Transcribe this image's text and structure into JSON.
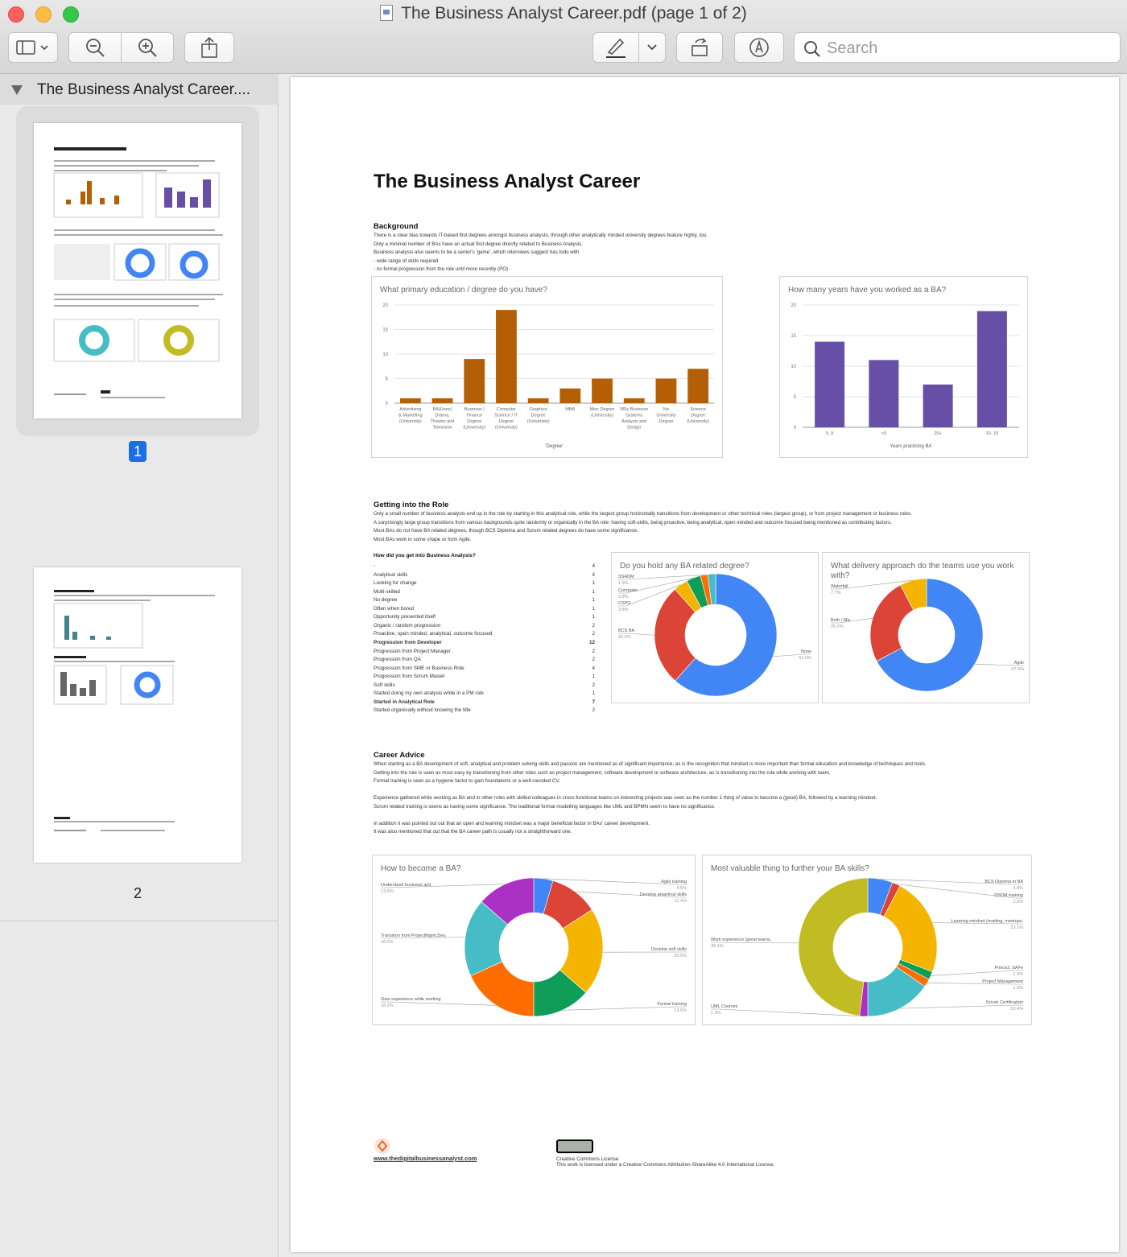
{
  "window": {
    "title": "The Business Analyst Career.pdf (page 1 of 2)",
    "search_placeholder": "Search"
  },
  "sidebar": {
    "doc_title": "The Business Analyst Career....",
    "page1": "1",
    "page2": "2"
  },
  "doc": {
    "title": "The Business Analyst Career",
    "background_heading": "Background",
    "background_text": [
      "There is a clear bias towards IT-based first degrees amongst business analysts, through other analytically minded university degrees feature highly, too.",
      "Only a minimal number of BAs have an actual first degree directly related to Business Analysis.",
      "Business analysis also seems to be a senior's 'game', which interviews suggest has todo with",
      "- wide range of skills required",
      "- no formal progression from the role until more recently (PO)"
    ],
    "role_heading": "Getting into the Role",
    "role_text": [
      "Only a small number of business analysts end up in the role by starting in this analytical role, while the largest group horizontally transitions from development or other technical roles (largest group), or from project management or business roles.",
      "A surprisingly large group transitions from various backgrounds quite randomly or organically in the BA role: having soft-skills, being proactive, being analytical, open minded and outcome focused being mentioned as contributing factors.",
      "Most BAs do not have BA related degrees, though BCS Diploma and Scrum related degrees do have some significance.",
      "Most BAs work in some shape or form Agile."
    ],
    "how_heading": "How did you get into Business Analysis?",
    "how_rows": [
      {
        "label": "-",
        "value": "4",
        "bold": false
      },
      {
        "label": "Analytical skills",
        "value": "4",
        "bold": false
      },
      {
        "label": "Looking for change",
        "value": "1",
        "bold": false
      },
      {
        "label": "Multi-skilled",
        "value": "1",
        "bold": false
      },
      {
        "label": "No degree",
        "value": "1",
        "bold": false
      },
      {
        "label": "Often when bored",
        "value": "1",
        "bold": false
      },
      {
        "label": "Opportunity presented itself",
        "value": "1",
        "bold": false
      },
      {
        "label": "Organic / random progression",
        "value": "2",
        "bold": false
      },
      {
        "label": "Proactive, open minded, analytical, outcome focused",
        "value": "2",
        "bold": false
      },
      {
        "label": "Progression from Developer",
        "value": "12",
        "bold": true
      },
      {
        "label": "Progression from Project Manager",
        "value": "2",
        "bold": false
      },
      {
        "label": "Progression from QA",
        "value": "2",
        "bold": false
      },
      {
        "label": "Progression from SME or Business Role",
        "value": "4",
        "bold": false
      },
      {
        "label": "Progression from Scrum Master",
        "value": "1",
        "bold": false
      },
      {
        "label": "Soft skills",
        "value": "2",
        "bold": false
      },
      {
        "label": "Started doing my own analysis while in a PM role",
        "value": "1",
        "bold": false
      },
      {
        "label": "Started in Analytical Role",
        "value": "7",
        "bold": true
      },
      {
        "label": "Started organically without knowing the title",
        "value": "2",
        "bold": false
      }
    ],
    "advice_heading": "Career Advice",
    "advice_text": [
      "When starting as a BA development of soft, analytical and problem solving skills and passion are mentioned as of significant importance, as is the recognition that mindset is more important than formal education and knowledge of techniques and tools.",
      "Getting into the role is seen as most easy by transitioning from other roles such as project management, software development or software architecture, as is transitioning into the role while working with team.",
      "Formal training is seen as a hygiene factor to gain foundations or a well-rounded CV.",
      "",
      "Experience gathered while working as BA and in other roles with skilled colleagues in cross-functional teams on interesting projects was seen as the number 1 thing of value to become a (good) BA, followed by a learning mindset.",
      "Scrum related training is seens as having some significance. The traditional formal modelling languages like UML and BPMN seem to have no significance.",
      "",
      "In addition it was pointed out out that an open and learning mindset was a major beneficial factor in BAs' career development.",
      "It was also mentioned that out that the BA career path is usually not a straightforward one."
    ],
    "footer_link": "www.thedigitalbusinessanalyst.com",
    "footer_cc1": "Creative Commons License",
    "footer_cc2": "This work is licensed under a Creative Commons Attribution-ShareAlike 4.0 International License."
  },
  "chart_data": [
    {
      "type": "bar",
      "title": "What primary education / degree do you have?",
      "xlabel": "'Degree'",
      "ylabel": "",
      "ylim": [
        0,
        20
      ],
      "yticks": [
        0,
        5,
        10,
        15,
        20
      ],
      "color": "#b45f06",
      "categories": [
        "Advertising & Marketing (University)",
        "BA(Hons) Drama, Theatre and Television",
        "Business / Finance Degree (University)",
        "Computer Science / IT Degree (University)",
        "Graphics Degree (University)",
        "MBA",
        "Misc Degree (University)",
        "MSc Business Systems Analysis and Design",
        "No University Degree",
        "Science Degree (University)"
      ],
      "values": [
        1,
        1,
        9,
        19,
        1,
        3,
        5,
        1,
        5,
        7
      ]
    },
    {
      "type": "bar",
      "title": "How many years have you worked as a BA?",
      "xlabel": "Years practicing BA",
      "ylabel": "",
      "ylim": [
        0,
        20
      ],
      "yticks": [
        0,
        5,
        10,
        15,
        20
      ],
      "color": "#674ea7",
      "categories": [
        "5..9",
        "<5",
        "20+",
        "10..19"
      ],
      "values": [
        14,
        11,
        7,
        19
      ]
    },
    {
      "type": "pie",
      "title": "Do you hold any BA related degree?",
      "slices": [
        {
          "label": "None",
          "pct": "61.5%",
          "value": 61.5,
          "color": "#4285f4"
        },
        {
          "label": "BCS BA",
          "pct": "26.9%",
          "value": 26.9,
          "color": "#db4437"
        },
        {
          "label": "CSPO",
          "pct": "3.8%",
          "value": 3.8,
          "color": "#f4b400"
        },
        {
          "label": "Computer",
          "pct": "3.8%",
          "value": 3.8,
          "color": "#0f9d58"
        },
        {
          "label": "SSADM",
          "pct": "1.9%",
          "value": 1.9,
          "color": "#ff6d00"
        },
        {
          "label": "",
          "pct": "",
          "value": 2.1,
          "color": "#46bdc6"
        }
      ]
    },
    {
      "type": "pie",
      "title": "What delivery approach do the teams use you work with?",
      "slices": [
        {
          "label": "Agile",
          "pct": "67.3%",
          "value": 67.3,
          "color": "#4285f4"
        },
        {
          "label": "Both / Mix",
          "pct": "25.0%",
          "value": 25.0,
          "color": "#db4437"
        },
        {
          "label": "Waterfall",
          "pct": "7.7%",
          "value": 7.7,
          "color": "#f4b400"
        }
      ]
    },
    {
      "type": "pie",
      "title": "How to become a BA?",
      "slices": [
        {
          "label": "Agile training",
          "pct": "4.5%",
          "value": 4.5,
          "color": "#4285f4"
        },
        {
          "label": "Develop analytical skills",
          "pct": "11.4%",
          "value": 11.4,
          "color": "#db4437"
        },
        {
          "label": "Develop soft skills",
          "pct": "20.5%",
          "value": 20.5,
          "color": "#f4b400"
        },
        {
          "label": "Formal training",
          "pct": "13.6%",
          "value": 13.6,
          "color": "#0f9d58"
        },
        {
          "label": "Gain experience while working",
          "pct": "18.2%",
          "value": 18.2,
          "color": "#ff6d00"
        },
        {
          "label": "Transition from ProjectMgmt,Dev,",
          "pct": "18.2%",
          "value": 18.2,
          "color": "#46bdc6"
        },
        {
          "label": "Understand business and",
          "pct": "13.6%",
          "value": 13.6,
          "color": "#ab30c4"
        }
      ]
    },
    {
      "type": "pie",
      "title": "Most valuable thing to further your BA skills?",
      "slices": [
        {
          "label": "BCS Diploma in BA",
          "pct": "5.8%",
          "value": 5.8,
          "color": "#4285f4"
        },
        {
          "label": "DSDM training",
          "pct": "1.9%",
          "value": 1.9,
          "color": "#db4437"
        },
        {
          "label": "Learning mindset (reading, meetups,",
          "pct": "23.1%",
          "value": 23.1,
          "color": "#f4b400"
        },
        {
          "label": "Prince2, SAFe",
          "pct": "1.9%",
          "value": 1.9,
          "color": "#0f9d58"
        },
        {
          "label": "Project Management",
          "pct": "1.9%",
          "value": 1.9,
          "color": "#ff6d00"
        },
        {
          "label": "Scrum Certification",
          "pct": "15.4%",
          "value": 15.4,
          "color": "#46bdc6"
        },
        {
          "label": "UML Courses",
          "pct": "1.9%",
          "value": 1.9,
          "color": "#ab30c4"
        },
        {
          "label": "Work experience (great teams,",
          "pct": "48.1%",
          "value": 48.1,
          "color": "#c2bc24"
        }
      ]
    }
  ]
}
